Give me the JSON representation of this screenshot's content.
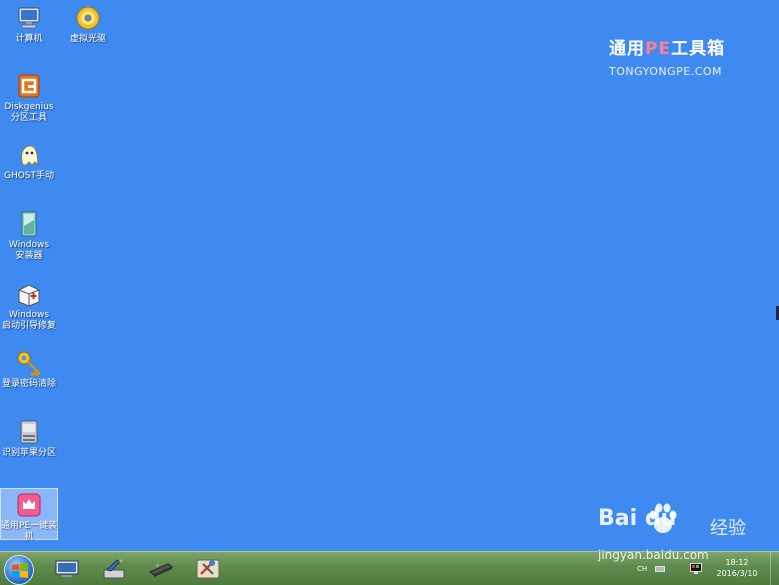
{
  "desktop": {
    "background": "#3f8af0",
    "icons": [
      {
        "id": "computer",
        "label": "计算机",
        "icon": "computer-icon"
      },
      {
        "id": "virtual-drive",
        "label": "虚拟光驱",
        "icon": "cd-drive-icon"
      },
      {
        "id": "diskgenius",
        "label_line1": "Diskgenius",
        "label_line2": "分区工具",
        "icon": "diskgenius-icon"
      },
      {
        "id": "ghost",
        "label": "GHOST手动",
        "icon": "ghost-icon"
      },
      {
        "id": "windows-installer",
        "label_line1": "Windows",
        "label_line2": "安装器",
        "icon": "installer-icon"
      },
      {
        "id": "boot-repair",
        "label_line1": "Windows",
        "label_line2": "启动引导修复",
        "icon": "first-aid-icon"
      },
      {
        "id": "password-clear",
        "label": "登录密码清除",
        "icon": "key-icon"
      },
      {
        "id": "apple-partition",
        "label": "识别苹果分区",
        "icon": "hard-drive-icon"
      },
      {
        "id": "one-click-install",
        "label_line1": "通用PE一键装",
        "label_line2": "机",
        "icon": "pink-crown-icon",
        "selected": true
      }
    ]
  },
  "brand": {
    "title_prefix": "通用",
    "title_pe": "PE",
    "title_suffix": "工具箱",
    "url": "TONGYONGPE.COM",
    "accent": "#ff7e8f"
  },
  "taskbar": {
    "buttons": [
      "monitor-icon",
      "paint-brush-icon",
      "memory-chip-icon",
      "tools-icon"
    ],
    "tray": {
      "language": "CH",
      "time": "18:12",
      "date": "2016/3/10"
    }
  },
  "watermark": {
    "logo": "Bai  du",
    "cn": "经验",
    "url": "jingyan.baidu.com"
  }
}
